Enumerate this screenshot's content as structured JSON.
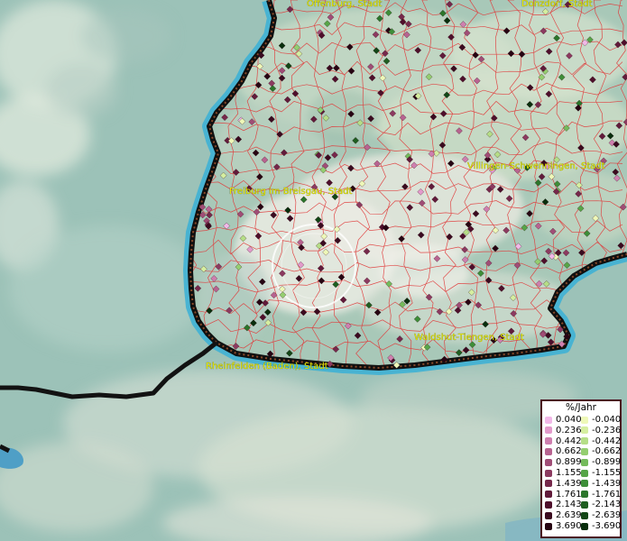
{
  "map": {
    "places": [
      {
        "id": "offenburg",
        "name": "Offenburg, Stadt"
      },
      {
        "id": "donzdorf",
        "name": "Donzdorf, Stadt"
      },
      {
        "id": "freiburg",
        "name": "Freiburg im Breisgau, Stadt"
      },
      {
        "id": "villingen",
        "name": "Villingen-Schwenningen, Stadt"
      },
      {
        "id": "waldshut",
        "name": "Waldshut-Tiengen, Stadt"
      },
      {
        "id": "rheinfelden",
        "name": "Rheinfelden (Baden), Stadt"
      }
    ]
  },
  "legend": {
    "title": "%/Jahr",
    "positive": [
      "0.040",
      "0.236",
      "0.442",
      "0.662",
      "0.899",
      "1.155",
      "1.439",
      "1.761",
      "2.143",
      "2.639",
      "3.690"
    ],
    "negative": [
      "-0.040",
      "-0.236",
      "-0.442",
      "-0.662",
      "-0.899",
      "-1.155",
      "-1.439",
      "-1.761",
      "-2.143",
      "-2.639",
      "-3.690"
    ],
    "positive_colors": [
      "#f2b8e8",
      "#e39acb",
      "#cf7faf",
      "#b86390",
      "#a04d76",
      "#8c3a60",
      "#76284b",
      "#611a3a",
      "#4e0f2b",
      "#3a0a1f",
      "#260412"
    ],
    "negative_colors": [
      "#eef8b8",
      "#d5eea0",
      "#b5de87",
      "#94ce70",
      "#74bb5b",
      "#56a548",
      "#3d8e38",
      "#2b762b",
      "#1e5e20",
      "#124616",
      "#082e0c"
    ]
  }
}
